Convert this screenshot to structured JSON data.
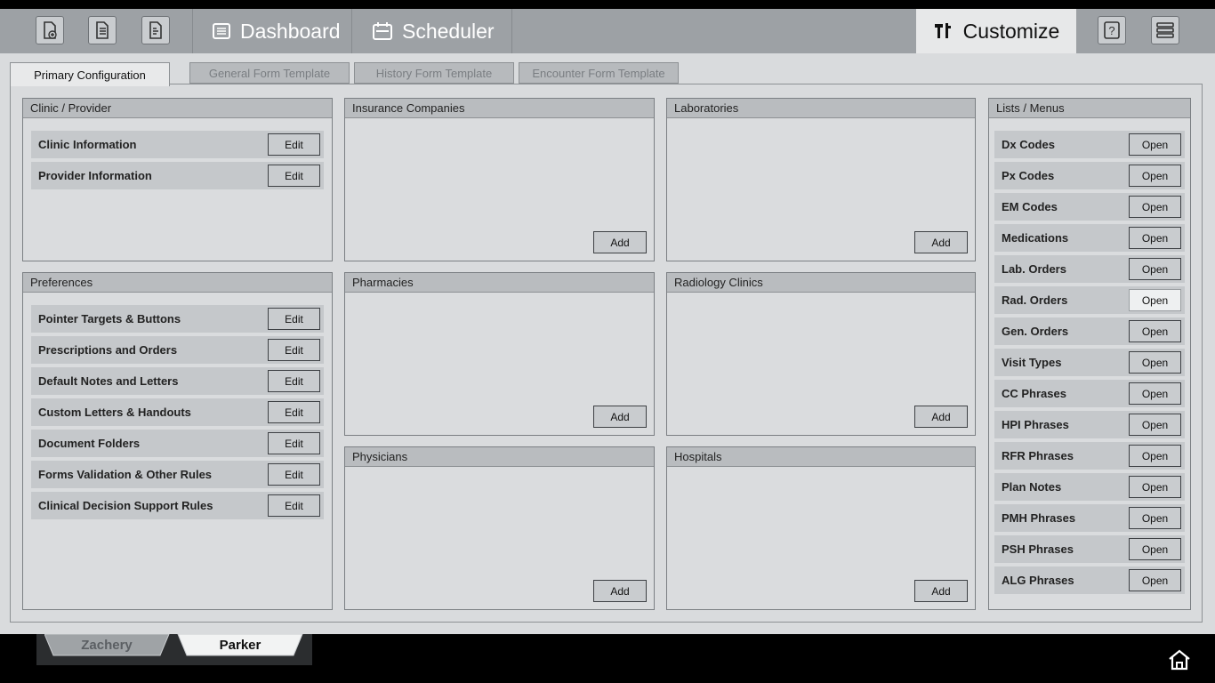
{
  "topbar": {
    "nav": [
      {
        "label": "Dashboard",
        "icon": "newspaper-icon"
      },
      {
        "label": "Scheduler",
        "icon": "calendar-icon"
      },
      {
        "label": "Customize",
        "icon": "tools-icon"
      }
    ],
    "left_icons": [
      "new-document-icon",
      "document-icon",
      "document-list-icon"
    ],
    "right_icons": [
      "help-icon",
      "menu-stack-icon"
    ]
  },
  "tabs": [
    {
      "label": "Primary Configuration",
      "active": true
    },
    {
      "label": "General Form Template",
      "active": false
    },
    {
      "label": "History Form Template",
      "active": false
    },
    {
      "label": "Encounter Form Template",
      "active": false
    }
  ],
  "panels": {
    "clinic": {
      "title": "Clinic / Provider",
      "items": [
        {
          "label": "Clinic Information",
          "action": "Edit"
        },
        {
          "label": "Provider Information",
          "action": "Edit"
        }
      ]
    },
    "preferences": {
      "title": "Preferences",
      "items": [
        {
          "label": "Pointer Targets & Buttons",
          "action": "Edit"
        },
        {
          "label": "Prescriptions and Orders",
          "action": "Edit"
        },
        {
          "label": "Default Notes and Letters",
          "action": "Edit"
        },
        {
          "label": "Custom Letters & Handouts",
          "action": "Edit"
        },
        {
          "label": "Document Folders",
          "action": "Edit"
        },
        {
          "label": "Forms Validation & Other Rules",
          "action": "Edit"
        },
        {
          "label": "Clinical Decision Support Rules",
          "action": "Edit"
        }
      ]
    },
    "insurance": {
      "title": "Insurance Companies",
      "action": "Add"
    },
    "laboratories": {
      "title": "Laboratories",
      "action": "Add"
    },
    "pharmacies": {
      "title": "Pharmacies",
      "action": "Add"
    },
    "radiology": {
      "title": "Radiology Clinics",
      "action": "Add"
    },
    "physicians": {
      "title": "Physicians",
      "action": "Add"
    },
    "hospitals": {
      "title": "Hospitals",
      "action": "Add"
    },
    "lists": {
      "title": "Lists / Menus",
      "items": [
        {
          "label": "Dx Codes",
          "action": "Open"
        },
        {
          "label": "Px Codes",
          "action": "Open"
        },
        {
          "label": "EM Codes",
          "action": "Open"
        },
        {
          "label": "Medications",
          "action": "Open"
        },
        {
          "label": "Lab. Orders",
          "action": "Open"
        },
        {
          "label": "Rad. Orders",
          "action": "Open",
          "highlighted": true
        },
        {
          "label": "Gen. Orders",
          "action": "Open"
        },
        {
          "label": "Visit Types",
          "action": "Open"
        },
        {
          "label": "CC Phrases",
          "action": "Open"
        },
        {
          "label": "HPI Phrases",
          "action": "Open"
        },
        {
          "label": "RFR Phrases",
          "action": "Open"
        },
        {
          "label": "Plan Notes",
          "action": "Open"
        },
        {
          "label": "PMH Phrases",
          "action": "Open"
        },
        {
          "label": "PSH Phrases",
          "action": "Open"
        },
        {
          "label": "ALG Phrases",
          "action": "Open"
        }
      ]
    }
  },
  "patient_tabs": [
    {
      "label": "Zachery",
      "active": false
    },
    {
      "label": "Parker",
      "active": true
    }
  ],
  "colors": {
    "topbar": "#9da1a5",
    "active_tab": "#e7e8e9",
    "panel_header": "#b9bcbf",
    "background": "#d9dbdd"
  }
}
